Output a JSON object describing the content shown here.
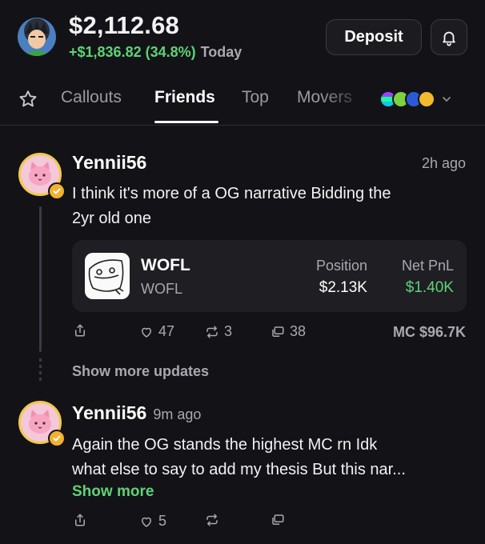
{
  "header": {
    "balance": "$2,112.68",
    "change": "+$1,836.82 (34.8%)",
    "period": "Today",
    "deposit_label": "Deposit"
  },
  "tabs": [
    {
      "label": "Callouts",
      "active": false
    },
    {
      "label": "Friends",
      "active": true
    },
    {
      "label": "Top",
      "active": false
    },
    {
      "label": "Movers",
      "active": false
    }
  ],
  "feed": {
    "show_more_updates": "Show more updates",
    "posts": [
      {
        "username": "Yennii56",
        "time": "2h ago",
        "text_line1": "I think it's more of a OG narrative Bidding the",
        "text_line2": "2yr old one",
        "card": {
          "name": "WOFL",
          "ticker": "WOFL",
          "position_label": "Position",
          "position_value": "$2.13K",
          "pnl_label": "Net PnL",
          "pnl_value": "$1.40K"
        },
        "likes": "47",
        "reposts": "3",
        "comments": "38",
        "mc": "MC $96.7K"
      },
      {
        "username": "Yennii56",
        "time": "9m ago",
        "text_line1": "Again the OG stands the highest MC rn Idk",
        "text_line2": "what else to say to add my thesis But this nar...",
        "show_more": "Show more",
        "likes": "5"
      }
    ]
  },
  "colors": {
    "background": "#131317",
    "gain": "#5fd276",
    "muted": "#a8a8b0",
    "verified": "#f2b230"
  }
}
